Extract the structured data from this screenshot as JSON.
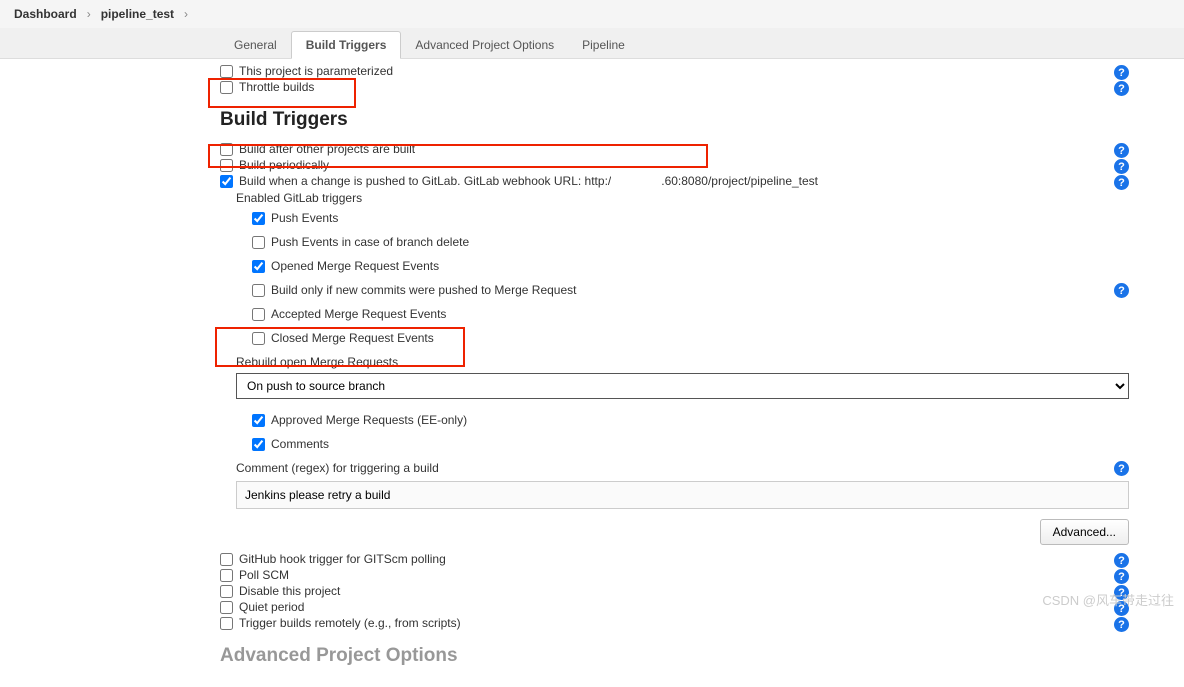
{
  "breadcrumb": {
    "dashboard": "Dashboard",
    "project": "pipeline_test"
  },
  "tabs": {
    "general": "General",
    "buildTriggers": "Build Triggers",
    "advanced": "Advanced Project Options",
    "pipeline": "Pipeline"
  },
  "opts": {
    "parameterized": "This project is parameterized",
    "throttle": "Throttle builds"
  },
  "section": {
    "buildTriggers": "Build Triggers",
    "advancedProjectOptions": "Advanced Project Options"
  },
  "bt": {
    "afterOther": "Build after other projects are built",
    "periodically": "Build periodically",
    "gitlabPush_pre": "Build when a change is pushed to GitLab. GitLab webhook URL: http:/",
    "gitlabPush_post": ".60:8080/project/pipeline_test",
    "enabledTriggers": "Enabled GitLab triggers",
    "pushEvents": "Push Events",
    "pushEventsBranchDelete": "Push Events in case of branch delete",
    "openedMR": "Opened Merge Request Events",
    "buildOnlyNewCommits": "Build only if new commits were pushed to Merge Request",
    "acceptedMR": "Accepted Merge Request Events",
    "closedMR": "Closed Merge Request Events",
    "rebuildLabel": "Rebuild open Merge Requests",
    "rebuildSelected": "On push to source branch",
    "approvedMR": "Approved Merge Requests (EE-only)",
    "comments": "Comments",
    "commentRegexLabel": "Comment (regex) for triggering a build",
    "commentRegexValue": "Jenkins please retry a build",
    "advancedBtn": "Advanced...",
    "githubHook": "GitHub hook trigger for GITScm polling",
    "pollSCM": "Poll SCM",
    "disableProject": "Disable this project",
    "quietPeriod": "Quiet period",
    "triggerRemote": "Trigger builds remotely (e.g., from scripts)"
  },
  "watermark": "CSDN @风车带走过往"
}
